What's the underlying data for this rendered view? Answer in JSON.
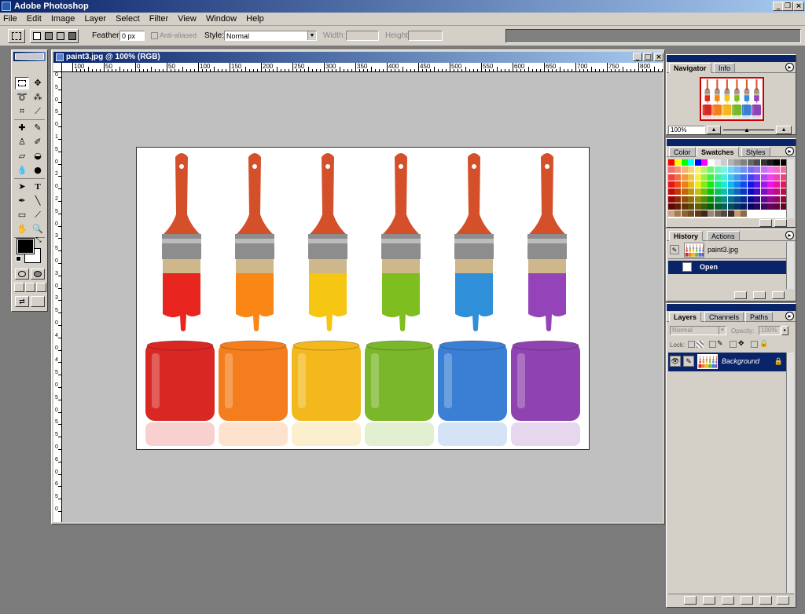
{
  "app": {
    "title": "Adobe Photoshop"
  },
  "menu": [
    "File",
    "Edit",
    "Image",
    "Layer",
    "Select",
    "Filter",
    "View",
    "Window",
    "Help"
  ],
  "options": {
    "feather_label": "Feather:",
    "feather_value": "0 px",
    "antialiased_label": "Anti-aliased",
    "style_label": "Style:",
    "style_value": "Normal",
    "width_label": "Width:",
    "height_label": "Height:"
  },
  "document": {
    "title": "paint3.jpg @ 100% (RGB)",
    "ruler_h_labels": [
      "100",
      "50",
      "0",
      "50",
      "100",
      "150",
      "200",
      "250",
      "300",
      "350",
      "400",
      "450",
      "500",
      "550",
      "600",
      "650",
      "700",
      "750",
      "800"
    ],
    "ruler_v_labels": [
      "0",
      "5",
      "0",
      "5",
      "0",
      "1",
      "5",
      "0",
      "2",
      "0",
      "2",
      "5",
      "0",
      "3",
      "5",
      "0",
      "3",
      "0",
      "3",
      "5",
      "0",
      "4",
      "0",
      "4",
      "5",
      "0",
      "5",
      "0",
      "5",
      "5",
      "0",
      "6",
      "0",
      "6",
      "5",
      "0"
    ],
    "artwork": {
      "brush_colors": [
        "#e8261f",
        "#f98615",
        "#f5c612",
        "#7fbe1f",
        "#2f8fd8",
        "#9444b8"
      ],
      "jar_colors": [
        "#d92824",
        "#f47e1e",
        "#f2b81c",
        "#7ab72a",
        "#3a7fd3",
        "#8f43b1"
      ],
      "handle_color": "#d4502a"
    }
  },
  "navigator": {
    "tabs": [
      "Navigator",
      "Info"
    ],
    "zoom": "100%"
  },
  "swatches": {
    "tabs": [
      "Color",
      "Swatches",
      "Styles"
    ]
  },
  "history": {
    "tabs": [
      "History",
      "Actions"
    ],
    "snapshot_label": "paint3.jpg",
    "step_label": "Open"
  },
  "layers": {
    "tabs": [
      "Layers",
      "Channels",
      "Paths"
    ],
    "blend_mode": "Normal",
    "opacity_label": "Opacity:",
    "opacity_value": "100%",
    "lock_label": "Lock:",
    "layer_name": "Background"
  }
}
